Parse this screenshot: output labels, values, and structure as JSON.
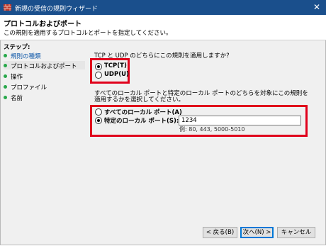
{
  "window": {
    "title": "新規の受信の規則ウィザード",
    "close_glyph": "✕"
  },
  "header": {
    "title": "プロトコルおよびポート",
    "subtitle": "この規則を適用するプロトコルとポートを指定してください。"
  },
  "steps": {
    "heading": "ステップ:",
    "items": [
      {
        "label": "規則の種類",
        "state": "done"
      },
      {
        "label": "プロトコルおよびポート",
        "state": "current"
      },
      {
        "label": "操作",
        "state": "pending"
      },
      {
        "label": "プロファイル",
        "state": "pending"
      },
      {
        "label": "名前",
        "state": "pending"
      }
    ]
  },
  "protocol": {
    "question": "TCP と UDP のどちらにこの規則を適用しますか?",
    "options": [
      {
        "label": "TCP(T)",
        "checked": true
      },
      {
        "label": "UDP(U)",
        "checked": false
      }
    ]
  },
  "ports": {
    "question": "すべてのローカル ポートと特定のローカル ポートのどちらを対象にこの規則を適用するかを選択してください。",
    "options": [
      {
        "label": "すべてのローカル ポート(A)",
        "checked": false
      },
      {
        "label": "特定のローカル ポート(S):",
        "checked": true
      }
    ],
    "input_value": "1234",
    "example": "例: 80, 443, 5000-5010"
  },
  "buttons": {
    "back": "< 戻る(B)",
    "next": "次へ(N) >",
    "cancel": "キャンセル"
  },
  "colors": {
    "titlebar": "#1a4f8c",
    "highlight_box": "#e0001b",
    "step_dot": "#27a84a",
    "step_done_text": "#0b56a8"
  }
}
